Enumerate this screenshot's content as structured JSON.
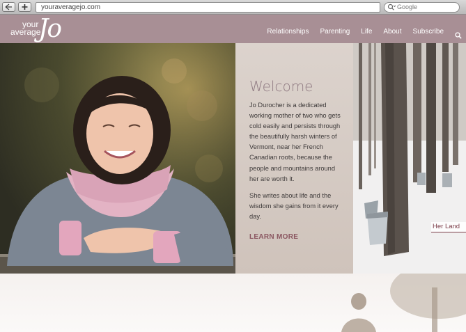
{
  "browser": {
    "back_icon": "back-arrow-icon",
    "add_icon": "plus-icon",
    "url": "youraveragejo.com",
    "search_placeholder": "Google",
    "search_icon": "magnifier-icon"
  },
  "site": {
    "logo": {
      "line1": "your",
      "line2": "average",
      "mark": "Jo"
    },
    "nav": [
      "Relationships",
      "Parenting",
      "Life",
      "About",
      "Subscribe"
    ],
    "nav_search_icon": "search-icon"
  },
  "welcome": {
    "title": "Welcome",
    "paragraphs": [
      "Jo Durocher is a dedicated working mother of two who gets cold easily and persists through the beautifully harsh winters of Vermont, near her French Canadian roots, because the people and mountains around her are worth it.",
      "She writes about life and the wisdom she gains from it every day."
    ],
    "cta": "LEARN MORE"
  },
  "forest": {
    "label": "Her Land"
  },
  "colors": {
    "header": "#a88f95",
    "welcome_title": "#907a82",
    "cta": "#8a5660",
    "herland": "#7b3c48"
  }
}
